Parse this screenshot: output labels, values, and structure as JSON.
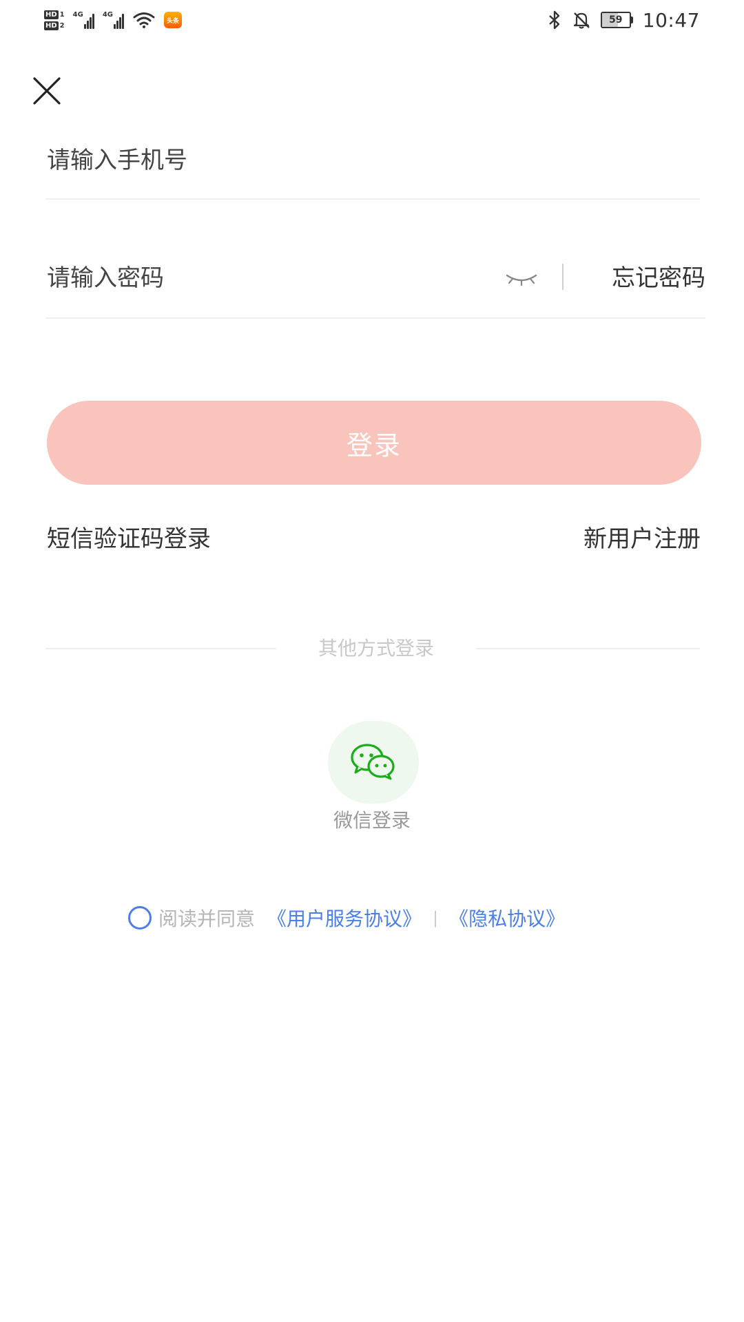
{
  "status_bar": {
    "hd1": "HD",
    "hd1_num": "1",
    "hd2": "HD",
    "hd2_num": "2",
    "sig1_label": "4G",
    "sig2_label": "4G",
    "app_badge": "头条",
    "battery": "59",
    "time": "10:47",
    "icons": [
      "bluetooth-icon",
      "bell-off-icon",
      "wifi-icon"
    ]
  },
  "form": {
    "phone_placeholder": "请输入手机号",
    "password_placeholder": "请输入密码",
    "forgot_password": "忘记密码"
  },
  "login_button": "登录",
  "links": {
    "sms_login": "短信验证码登录",
    "register": "新用户注册"
  },
  "other_login": {
    "divider_label": "其他方式登录",
    "wechat_label": "微信登录"
  },
  "agreement": {
    "prefix": "阅读并同意",
    "user_agreement": "《用户服务协议》",
    "separator": "|",
    "privacy_policy": "《隐私协议》"
  },
  "colors": {
    "login_button_bg": "#f9c4bb",
    "link_blue": "#4a7ee8",
    "wechat_green": "#1aad19",
    "wechat_bg": "#eef8ee"
  }
}
